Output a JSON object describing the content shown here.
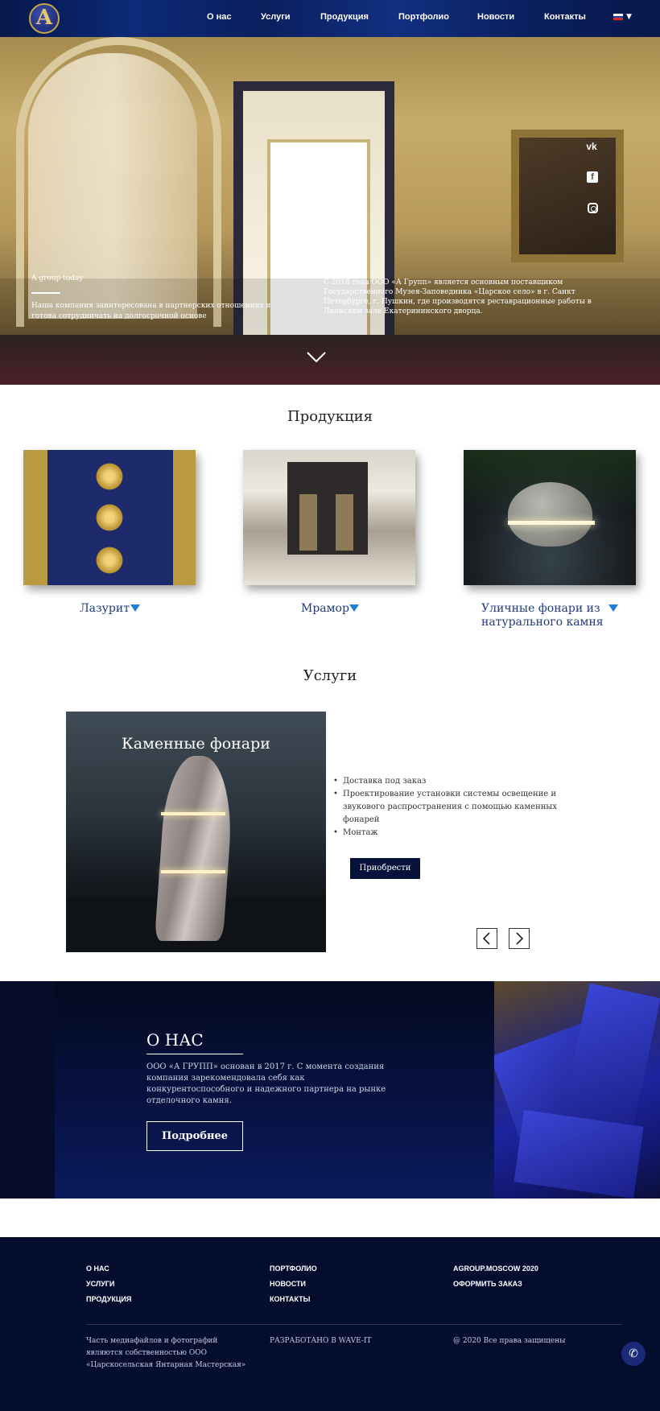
{
  "header": {
    "logo_letter": "A",
    "nav": [
      "О нас",
      "Услуги",
      "Продукция",
      "Портфолио",
      "Новости",
      "Контакты"
    ],
    "flag_colors": [
      "#ffffff",
      "#1c3fb0",
      "#d52b1e"
    ]
  },
  "hero": {
    "social": {
      "vk": "vk",
      "fb": "f"
    },
    "left_title": "A group today",
    "left_text": "Наша компания заинтересована в партнерских отношениях и готова сотрудничать на долгосрочной основе",
    "right_text": "С 2018 года ООО «А Групп» является основным поставщиком Государственного Музея-Заповедника «Царское село» в г. Санкт Петербурге, г. Пушкин, где производятся реставрационные работы в Лионском зале Екатерининского дворца."
  },
  "products": {
    "title": "Продукция",
    "items": [
      {
        "label": "Лазурит"
      },
      {
        "label": "Мрамор"
      },
      {
        "label_line1": "Уличные фонари из",
        "label_line2": "натурального камня"
      }
    ]
  },
  "services": {
    "title": "Услуги",
    "card_title": "Каменные фонари",
    "list": [
      "Доставка под заказ",
      "Проектирование установки системы освещение и звукового распространения с помощью каменных фонарей",
      "Монтаж"
    ],
    "buy_label": "Приобрести"
  },
  "about": {
    "title": "О НАС",
    "text": "ООО «А ГРУПП» основан в 2017 г. С момента создания компания зарекомендовала себя как конкурентоспособного и надежного партнера на рынке отделочного камня.",
    "more_label": "Подробнее"
  },
  "footer": {
    "col1": [
      "О НАС",
      "УСЛУГИ",
      "ПРОДУКЦИЯ"
    ],
    "col2": [
      "ПОРТФОЛИО",
      "НОВОСТИ",
      "КОНТАКТЫ"
    ],
    "col3": [
      "AGROUP.MOSCOW 2020",
      "ОФОРМИТЬ ЗАКАЗ"
    ],
    "note": "Часть медиафайлов и фотографий являются собственностью ООО «Царскосельская Янтарная Мастерская»",
    "dev": "РАЗРАБОТАНО В WAVE-IT",
    "rights": "@ 2020 Все права защищены"
  }
}
